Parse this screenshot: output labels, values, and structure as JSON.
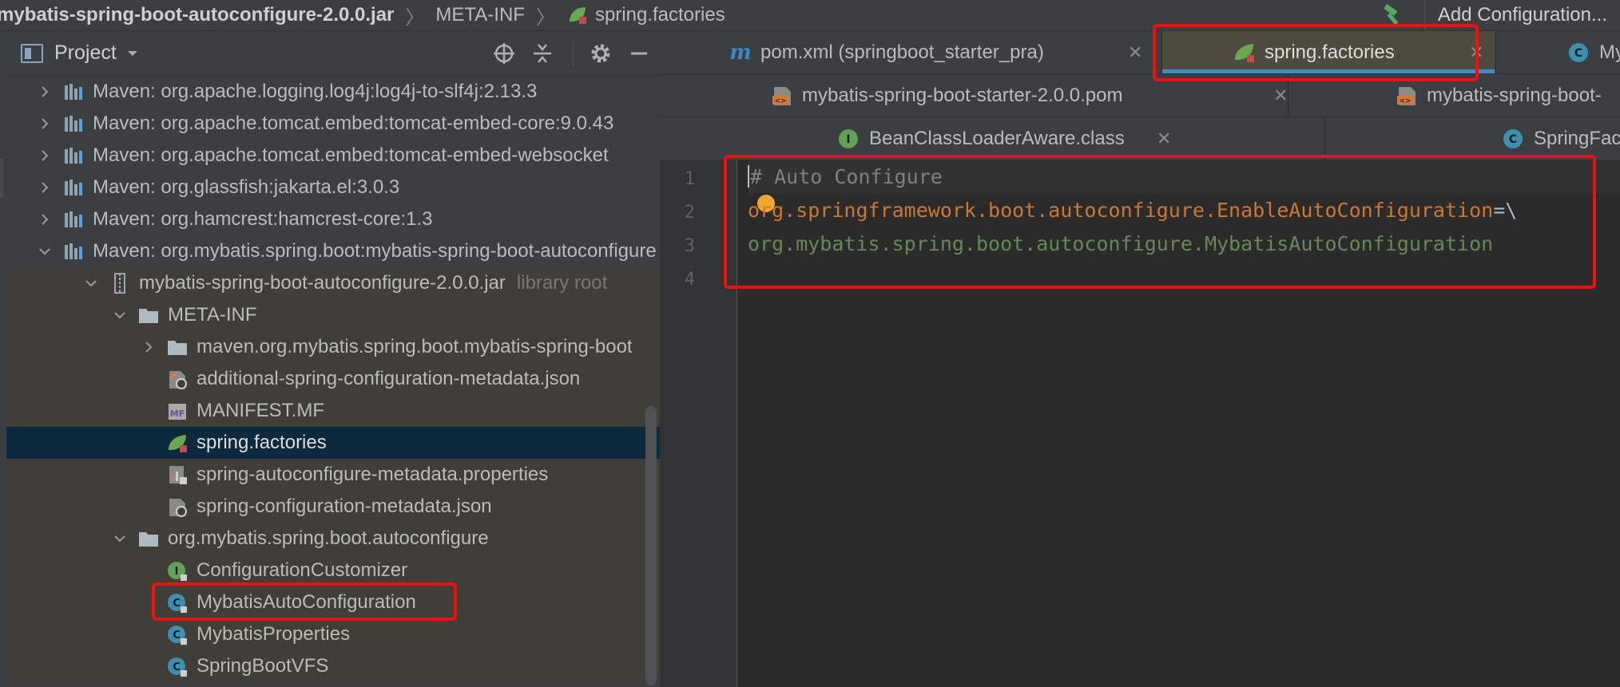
{
  "breadcrumb": {
    "jar": "mybatis-spring-boot-autoconfigure-2.0.0.jar",
    "folder": "META-INF",
    "file": "spring.factories"
  },
  "toolbar": {
    "add_configuration": "Add Configuration..."
  },
  "project_panel": {
    "title": "Project"
  },
  "tree": {
    "rows": [
      {
        "label": "Maven: org.apache.logging.log4j:log4j-to-slf4j:2.13.3",
        "icon": "maven-library-icon"
      },
      {
        "label": "Maven: org.apache.tomcat.embed:tomcat-embed-core:9.0.43",
        "icon": "maven-library-icon"
      },
      {
        "label": "Maven: org.apache.tomcat.embed:tomcat-embed-websocket",
        "icon": "maven-library-icon"
      },
      {
        "label": "Maven: org.glassfish:jakarta.el:3.0.3",
        "icon": "maven-library-icon"
      },
      {
        "label": "Maven: org.hamcrest:hamcrest-core:1.3",
        "icon": "maven-library-icon"
      },
      {
        "label": "Maven: org.mybatis.spring.boot:mybatis-spring-boot-autoconfigure",
        "icon": "maven-library-icon"
      },
      {
        "label": "mybatis-spring-boot-autoconfigure-2.0.0.jar",
        "suffix": "library root",
        "icon": "jar-icon"
      },
      {
        "label": "META-INF",
        "icon": "folder-icon"
      },
      {
        "label": "maven.org.mybatis.spring.boot.mybatis-spring-boot",
        "icon": "folder-icon"
      },
      {
        "label": "additional-spring-configuration-metadata.json",
        "icon": "json-config-icon"
      },
      {
        "label": "MANIFEST.MF",
        "icon": "manifest-icon"
      },
      {
        "label": "spring.factories",
        "icon": "spring-leaf-icon"
      },
      {
        "label": "spring-autoconfigure-metadata.properties",
        "icon": "properties-icon"
      },
      {
        "label": "spring-configuration-metadata.json",
        "icon": "json-config-icon"
      },
      {
        "label": "org.mybatis.spring.boot.autoconfigure",
        "icon": "package-icon"
      },
      {
        "label": "ConfigurationCustomizer",
        "icon": "interface-icon"
      },
      {
        "label": "MybatisAutoConfiguration",
        "icon": "class-icon"
      },
      {
        "label": "MybatisProperties",
        "icon": "class-icon"
      },
      {
        "label": "SpringBootVFS",
        "icon": "class-icon"
      }
    ]
  },
  "tabs": {
    "row1": [
      {
        "label": "pom.xml (springboot_starter_pra)",
        "icon": "maven-m-icon"
      },
      {
        "label": "spring.factories",
        "icon": "spring-leaf-icon",
        "active": true
      },
      {
        "label": "My",
        "icon": "class-icon"
      }
    ],
    "row2": [
      {
        "label": "mybatis-spring-boot-starter-2.0.0.pom",
        "icon": "pom-icon"
      },
      {
        "label": "mybatis-spring-boot-",
        "icon": "pom-icon"
      }
    ],
    "row3": [
      {
        "label": "BeanClassLoaderAware.class",
        "icon": "interface-icon"
      },
      {
        "label": "SpringFac",
        "icon": "class-icon"
      }
    ]
  },
  "editor": {
    "line_numbers": [
      "1",
      "2",
      "3",
      "4"
    ],
    "lines": {
      "l1_comment": "# Auto Configure",
      "l2_key": "org.springframework.boot.autoconfigure.EnableAutoConfiguration",
      "l2_eq": "=\\",
      "l3_value": "org.mybatis.spring.boot.autoconfigure.MybatisAutoConfiguration"
    }
  },
  "colors": {
    "comment": "#808080",
    "key": "#cc7832",
    "value": "#6a8759",
    "highlight_box": "#ee1111",
    "selection": "#0d293e",
    "active_tab_underline": "#4a88c7"
  }
}
